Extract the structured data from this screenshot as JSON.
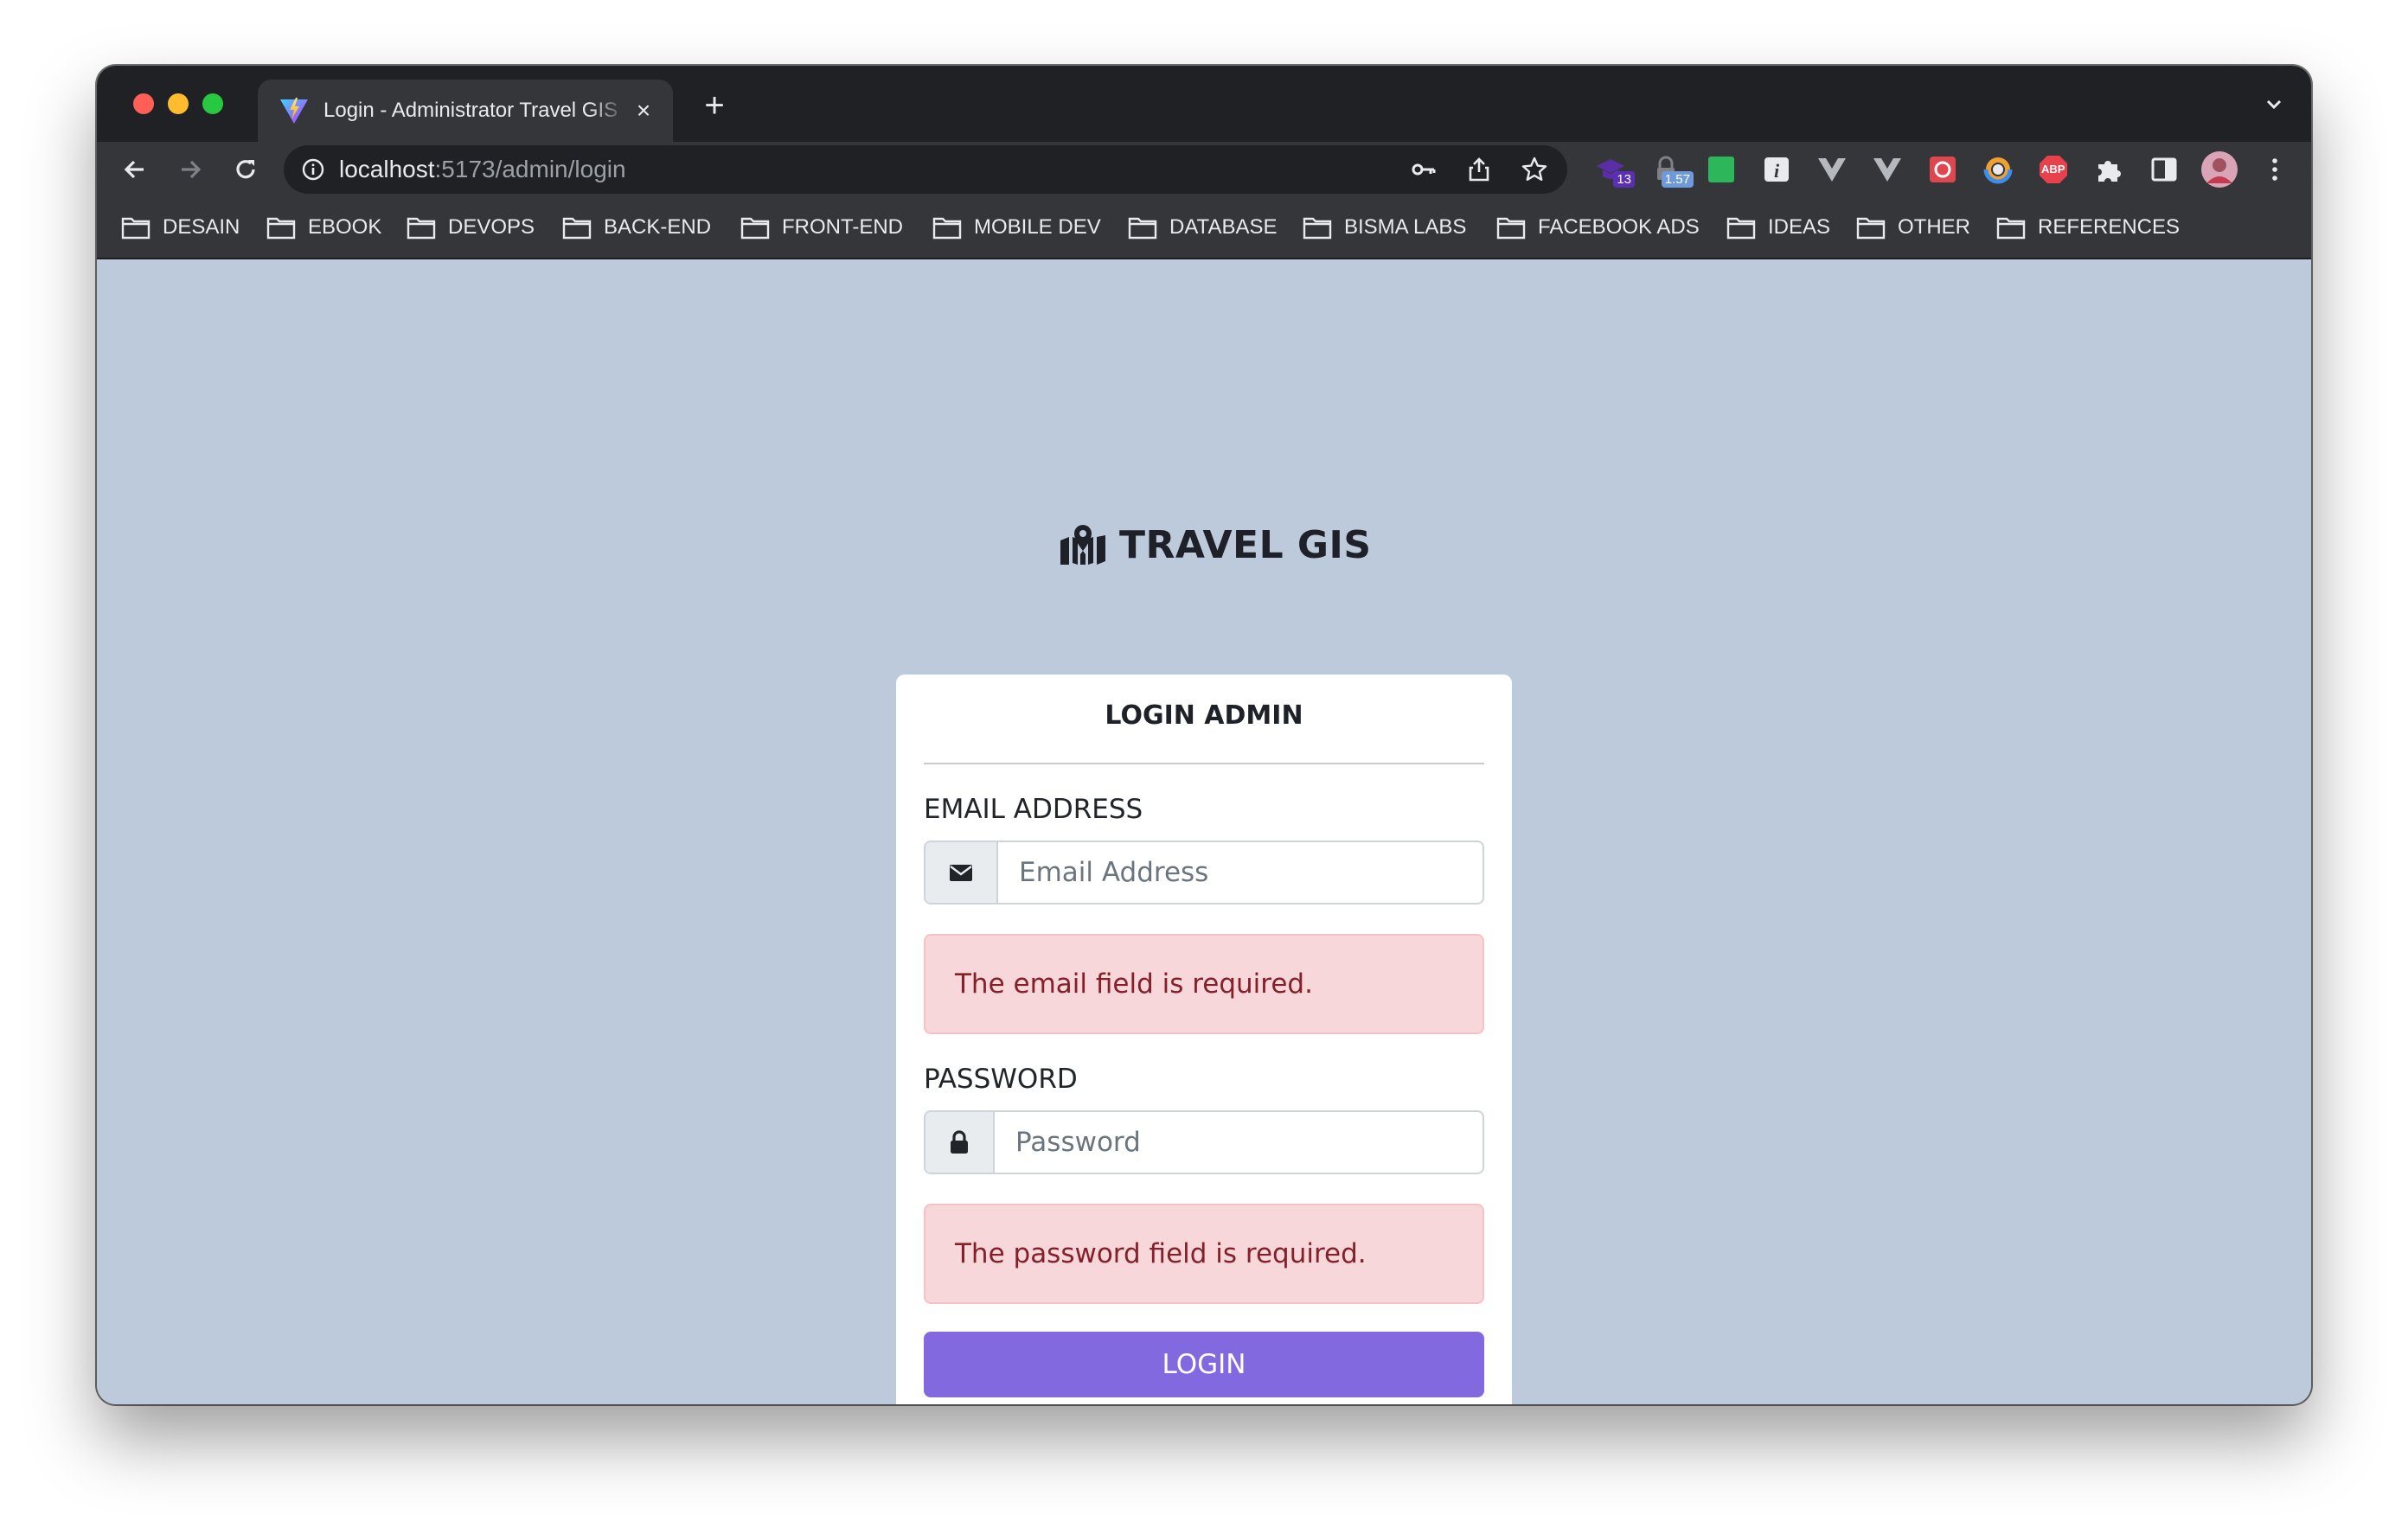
{
  "browser": {
    "tab_title": "Login - Administrator Travel GIS",
    "new_tab": "+",
    "tab_close": "×",
    "url_host": "localhost",
    "url_path": ":5173/admin/login",
    "extension_badges": {
      "ext1": "13",
      "ext2": "1.57",
      "abp": "ABP"
    },
    "bookmarks": [
      "DESAIN",
      "EBOOK",
      "DEVOPS",
      "BACK-END",
      "FRONT-END",
      "MOBILE DEV",
      "DATABASE",
      "BISMA LABS",
      "FACEBOOK ADS",
      "IDEAS",
      "OTHER",
      "REFERENCES"
    ]
  },
  "page": {
    "brand": "TRAVEL GIS",
    "card_title": "LOGIN ADMIN",
    "email": {
      "label": "EMAIL ADDRESS",
      "placeholder": "Email Address",
      "value": "",
      "error": "The email field is required."
    },
    "password": {
      "label": "PASSWORD",
      "placeholder": "Password",
      "value": "",
      "error": "The password field is required."
    },
    "submit_label": "LOGIN"
  },
  "colors": {
    "page_background": "#bccadb",
    "accent_button": "#8369e0",
    "alert_background": "#f8d7da",
    "alert_text": "#842029"
  },
  "icons": {
    "brand": "map-location-icon",
    "email_addon": "envelope-icon",
    "password_addon": "lock-icon"
  }
}
